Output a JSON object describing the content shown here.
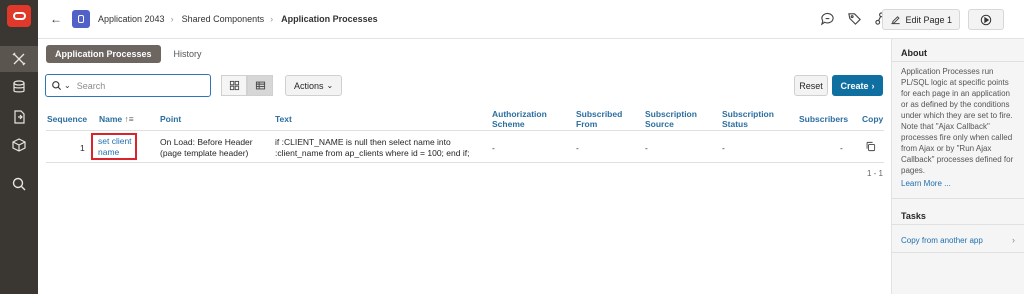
{
  "header": {
    "breadcrumb": [
      "Application 2043",
      "Shared Components",
      "Application Processes"
    ],
    "edit_page_label": "Edit Page 1"
  },
  "tabs": {
    "active": "Application Processes",
    "other": "History"
  },
  "toolbar": {
    "search_placeholder": "Search",
    "actions_label": "Actions",
    "reset_label": "Reset",
    "create_label": "Create"
  },
  "table": {
    "columns": [
      "Sequence",
      "Name",
      "Point",
      "Text",
      "Authorization Scheme",
      "Subscribed From",
      "Subscription Source",
      "Subscription Status",
      "Subscribers",
      "Copy"
    ],
    "rows": [
      {
        "sequence": "1",
        "name": "set client name",
        "point": "On Load: Before Header (page template header)",
        "text": "if :CLIENT_NAME is null then select name into :client_name from ap_clients where id = 100; end if; ...",
        "authorization_scheme": "-",
        "subscribed_from": "-",
        "subscription_source": "-",
        "subscription_status": "-",
        "subscribers": "-"
      }
    ],
    "pagination": "1 - 1"
  },
  "right_panel": {
    "about_title": "About",
    "about_text": "Application Processes run PL/SQL logic at specific points for each page in an application or as defined by the conditions under which they are set to fire. Note that \"Ajax Callback\" processes fire only when called from Ajax or by \"Run Ajax Callback\" processes defined for pages.",
    "learn_more": "Learn More ...",
    "tasks_title": "Tasks",
    "task_link": "Copy from another app"
  },
  "colors": {
    "rail": "#3a3632",
    "accent": "#0f6fa1",
    "link": "#1f6fb0",
    "highlight": "#d9232d"
  }
}
